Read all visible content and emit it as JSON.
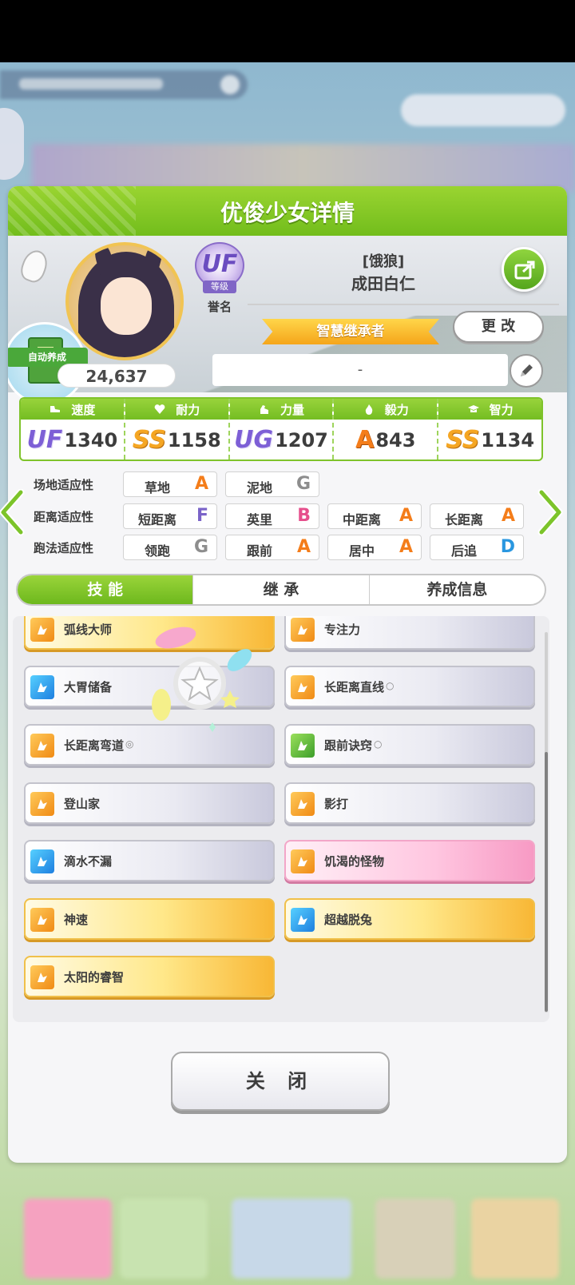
{
  "panel": {
    "title": "优俊少女详情"
  },
  "profile": {
    "auto_badge": "自动养成",
    "fans": "24,637",
    "rank_emblem": "UF",
    "rank_sub": "等级",
    "honor_label": "誉名",
    "title": "[饿狼]",
    "name": "成田白仁",
    "inherit_ribbon": "智慧继承者",
    "change_button": "更 改",
    "comment": "-"
  },
  "stats": [
    {
      "label": "速度",
      "grade": "UF",
      "value": "1340",
      "icon": "shoe-icon"
    },
    {
      "label": "耐力",
      "grade": "SS",
      "value": "1158",
      "icon": "heart-icon"
    },
    {
      "label": "力量",
      "grade": "UG",
      "value": "1207",
      "icon": "arm-icon"
    },
    {
      "label": "毅力",
      "grade": "A",
      "value": "843",
      "icon": "flame-icon"
    },
    {
      "label": "智力",
      "grade": "SS",
      "value": "1134",
      "icon": "cap-icon"
    }
  ],
  "aptitude": {
    "track": {
      "label": "场地适应性",
      "items": [
        {
          "name": "草地",
          "grade": "A"
        },
        {
          "name": "泥地",
          "grade": "G"
        }
      ]
    },
    "distance": {
      "label": "距离适应性",
      "items": [
        {
          "name": "短距离",
          "grade": "F"
        },
        {
          "name": "英里",
          "grade": "B"
        },
        {
          "name": "中距离",
          "grade": "A"
        },
        {
          "name": "长距离",
          "grade": "A"
        }
      ]
    },
    "style": {
      "label": "跑法适应性",
      "items": [
        {
          "name": "领跑",
          "grade": "G"
        },
        {
          "name": "跟前",
          "grade": "A"
        },
        {
          "name": "居中",
          "grade": "A"
        },
        {
          "name": "后追",
          "grade": "D"
        }
      ]
    }
  },
  "tabs": [
    "技 能",
    "继 承",
    "养成信息"
  ],
  "skills": [
    {
      "name": "弧线大师",
      "mark": "",
      "style": "gold",
      "icon": "orange"
    },
    {
      "name": "专注力",
      "mark": "",
      "style": "normal",
      "icon": "orange"
    },
    {
      "name": "大胃储备",
      "mark": "",
      "style": "normal",
      "icon": "blue"
    },
    {
      "name": "长距离直线",
      "mark": "○",
      "style": "normal",
      "icon": "orange"
    },
    {
      "name": "长距离弯道",
      "mark": "◎",
      "style": "normal",
      "icon": "orange"
    },
    {
      "name": "跟前诀窍",
      "mark": "○",
      "style": "normal",
      "icon": "green"
    },
    {
      "name": "登山家",
      "mark": "",
      "style": "normal",
      "icon": "orange"
    },
    {
      "name": "影打",
      "mark": "",
      "style": "normal",
      "icon": "orange"
    },
    {
      "name": "滴水不漏",
      "mark": "",
      "style": "normal",
      "icon": "blue"
    },
    {
      "name": "饥渴的怪物",
      "mark": "",
      "style": "pink",
      "icon": "orange"
    },
    {
      "name": "神速",
      "mark": "",
      "style": "gold",
      "icon": "orange"
    },
    {
      "name": "超越脱兔",
      "mark": "",
      "style": "gold",
      "icon": "blue"
    },
    {
      "name": "太阳的睿智",
      "mark": "",
      "style": "gold",
      "icon": "orange"
    }
  ],
  "close_button": "关 闭",
  "colors": {
    "accent_green": "#74bd22",
    "gold": "#f5a623",
    "uf_purple": "#7d5fd6"
  }
}
